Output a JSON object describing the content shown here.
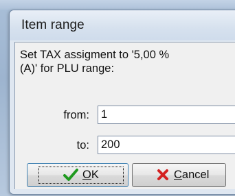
{
  "window": {
    "title": "Item range"
  },
  "message": {
    "line1": "Set TAX assigment to '5,00 %",
    "line2": "(A)' for PLU range:"
  },
  "fields": {
    "from": {
      "label": "from:",
      "value": "1"
    },
    "to": {
      "label": "to:",
      "value": "200"
    }
  },
  "buttons": {
    "ok": {
      "mnemonic": "O",
      "rest": "K",
      "icon": "checkmark-icon"
    },
    "cancel": {
      "mnemonic": "C",
      "rest": "ancel",
      "icon": "red-x-icon"
    }
  },
  "colors": {
    "ok_icon": "#1f9a1f",
    "cancel_icon": "#d42020"
  }
}
